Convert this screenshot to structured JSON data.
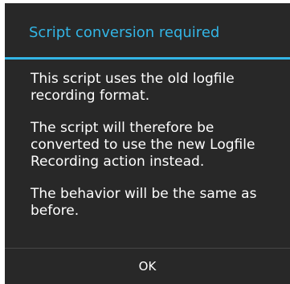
{
  "dialog": {
    "title": "Script conversion required",
    "message": [
      "This script uses the old logfile recording format.",
      "The script will therefore be converted to use the new Logfile Recording action instead.",
      "The behavior will be the same as before."
    ],
    "ok_label": "OK",
    "accent_color": "#33b5e5",
    "background_color": "#282828"
  }
}
